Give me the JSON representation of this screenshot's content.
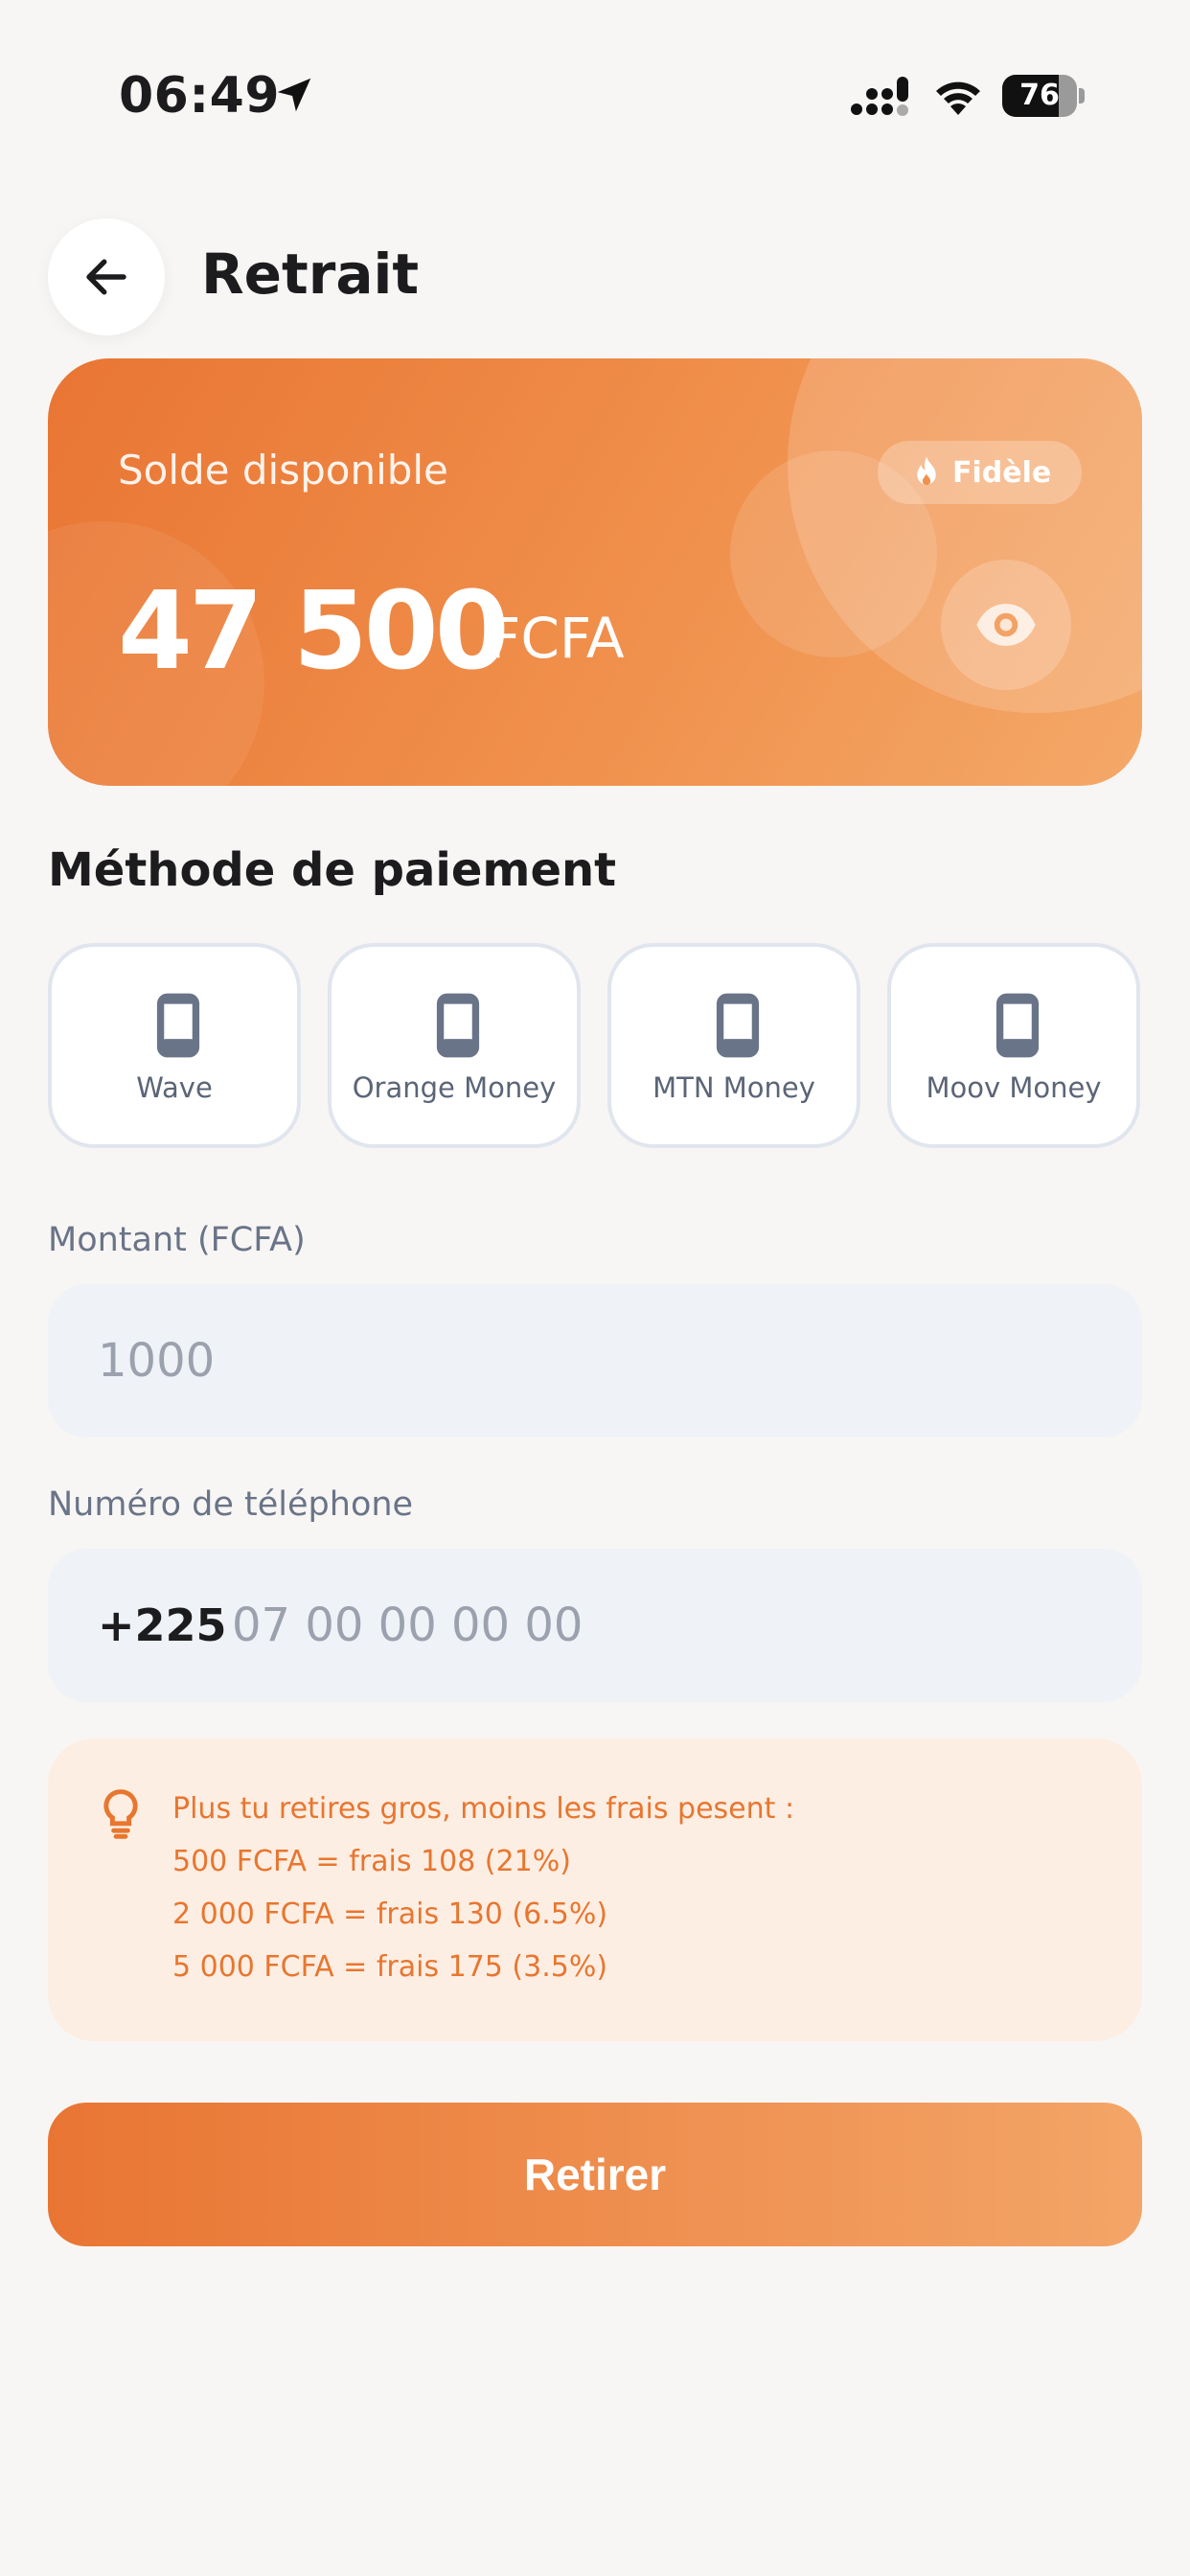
{
  "status_bar": {
    "time": "06:49",
    "battery_level": "76",
    "battery_fraction": 0.76
  },
  "header": {
    "title": "Retrait",
    "back_icon": "arrow-left-icon"
  },
  "balance": {
    "label": "Solde disponible",
    "badge": "Fidèle",
    "badge_icon": "flame-icon",
    "amount": "47 500",
    "currency": "FCFA",
    "visibility_icon": "eye-icon"
  },
  "payment": {
    "title": "Méthode de paiement",
    "methods": [
      {
        "label": "Wave",
        "icon": "phone-icon"
      },
      {
        "label": "Orange Money",
        "icon": "phone-icon"
      },
      {
        "label": "MTN Money",
        "icon": "phone-icon"
      },
      {
        "label": "Moov Money",
        "icon": "phone-icon"
      }
    ]
  },
  "amount_field": {
    "label": "Montant (FCFA)",
    "placeholder": "1000",
    "value": ""
  },
  "phone_field": {
    "label": "Numéro de téléphone",
    "prefix": "+225",
    "placeholder": "07 00 00 00 00",
    "value": ""
  },
  "tip": {
    "icon": "lightbulb-icon",
    "lines": [
      "Plus tu retires gros, moins les frais pesent :",
      "500 FCFA = frais 108 (21%)",
      "2 000 FCFA = frais 130 (6.5%)",
      "5 000 FCFA = frais 175 (3.5%)"
    ]
  },
  "actions": {
    "withdraw_label": "Retirer"
  },
  "colors": {
    "accent": "#e97533",
    "accent_light": "#f3a567",
    "tip_background": "#fdeee3",
    "tip_text": "#e8762f",
    "field_background": "#eff2f7"
  }
}
